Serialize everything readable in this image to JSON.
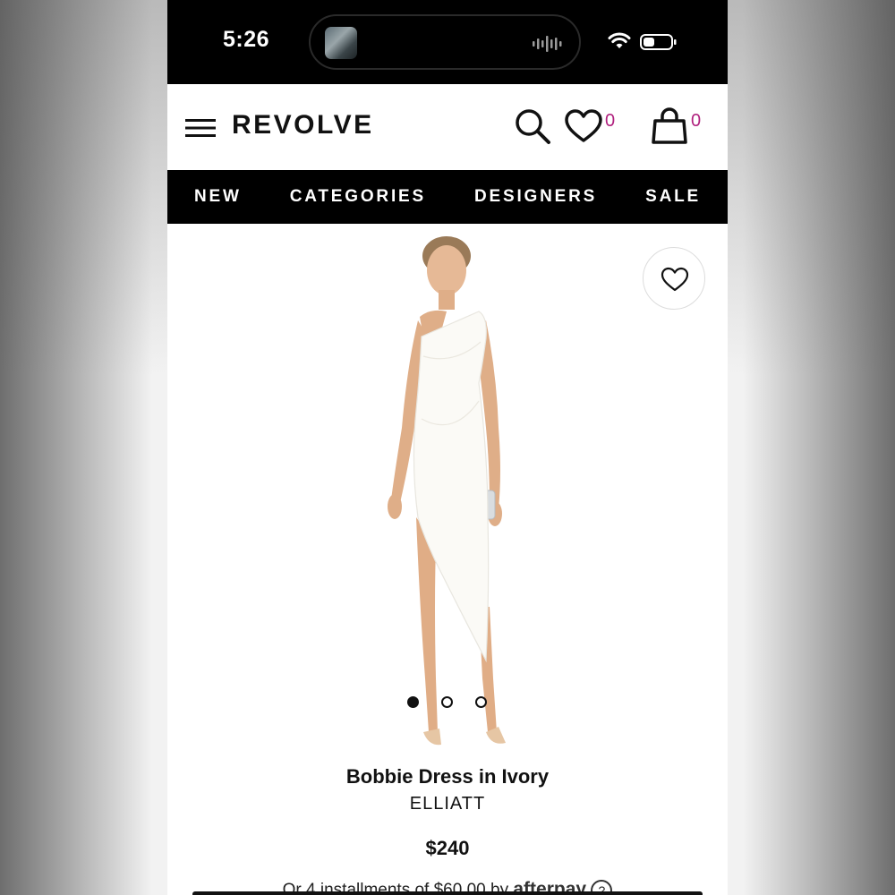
{
  "status_bar": {
    "time": "5:26"
  },
  "header": {
    "brand": "REVOLVE",
    "wishlist_count": "0",
    "bag_count": "0"
  },
  "nav": {
    "items": [
      "NEW",
      "CATEGORIES",
      "DESIGNERS",
      "SALE"
    ]
  },
  "product": {
    "name": "Bobbie Dress in Ivory",
    "brand": "ELLIATT",
    "price": "$240",
    "installments_text": "Or 4 installments of $60.00 by",
    "installments_provider": "afterpay",
    "image_count": 3,
    "active_image": 1
  },
  "colors": {
    "count_accent": "#b0207e",
    "nav_background": "#000000",
    "dress": "#fbfaf6"
  }
}
